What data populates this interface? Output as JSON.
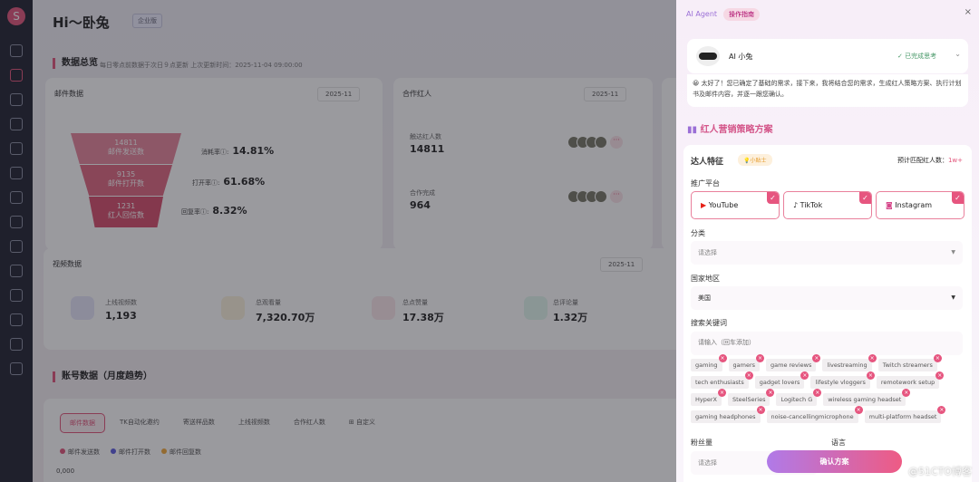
{
  "sidebar": {
    "logo": "S"
  },
  "header": {
    "greeting": "Hi～卧兔",
    "badge": "企业版"
  },
  "overview": {
    "title": "数据总览",
    "subtitle": "每日零点前数据于次日９点更新 上次更新时间：2025-11-04 09:00:00"
  },
  "mail": {
    "title": "邮件数据",
    "date": "2025-11",
    "funnel": [
      {
        "value": "14811",
        "label": "邮件发送数"
      },
      {
        "value": "9135",
        "label": "邮件打开数"
      },
      {
        "value": "1231",
        "label": "红人回信数"
      }
    ],
    "rates": [
      {
        "label": "消耗率",
        "value": "14.81%"
      },
      {
        "label": "打开率",
        "value": "61.68%"
      },
      {
        "label": "回复率",
        "value": "8.32%"
      }
    ]
  },
  "partners": {
    "title": "合作红人",
    "date": "2025-11",
    "items": [
      {
        "label": "触达红人数",
        "value": "14811"
      },
      {
        "label": "合作完成",
        "value": "964"
      }
    ],
    "more": "···"
  },
  "video": {
    "title": "视频数据",
    "date": "2025-11",
    "stats": [
      {
        "label": "上线视频数",
        "value": "1,193",
        "color": "#8b8fe0"
      },
      {
        "label": "总观看量",
        "value": "7,320.70万",
        "color": "#f2c94c"
      },
      {
        "label": "总点赞量",
        "value": "17.38万",
        "color": "#e2557a"
      },
      {
        "label": "总评论量",
        "value": "1.32万",
        "color": "#4fcf9a"
      }
    ]
  },
  "account": {
    "title": "账号数据（月度趋势）",
    "tabs": [
      "邮件数据",
      "TK自动化邀约",
      "寄送样品数",
      "上线视频数",
      "合作红人数"
    ],
    "customize": "自定义",
    "legend": [
      {
        "name": "邮件发送数",
        "color": "#e2557a"
      },
      {
        "name": "邮件打开数",
        "color": "#5b5be0"
      },
      {
        "name": "邮件回复数",
        "color": "#f2a93b"
      }
    ],
    "y_tick": "0,000"
  },
  "panel": {
    "agent": "AI Agent",
    "guide": "操作指南",
    "close": "×",
    "ai_name": "AI 小兔",
    "status": "已完成思考",
    "message": "😀 太好了！您已确定了基础的需求，接下来，我将结合您的需求，生成红人策略方案、执行计划书及邮件内容，并逐一跟您确认。",
    "plan_title": "红人营销策略方案",
    "feature": {
      "title": "达人特征",
      "tip": "小贴士",
      "estimate_label": "预计匹配红人数：",
      "estimate_value": "1w+"
    },
    "platform_label": "推广平台",
    "platforms": [
      {
        "name": "YouTube",
        "color": "#e62117"
      },
      {
        "name": "TikTok",
        "color": "#111"
      },
      {
        "name": "Instagram",
        "color": "#d6478a"
      }
    ],
    "category_label": "分类",
    "category_placeholder": "请选择",
    "region_label": "国家地区",
    "region_value": "美国",
    "keyword_label": "搜索关键词",
    "keyword_placeholder": "请输入（回车添加）",
    "tags": [
      "gaming",
      "gamers",
      "game reviews",
      "livestreaming",
      "Twitch streamers",
      "tech enthusiasts",
      "gadget lovers",
      "lifestyle vloggers",
      "remotework setup",
      "HyperX",
      "SteelSeries",
      "Logitech G",
      "wireless gaming headset",
      "gaming headphones",
      "noise-cancellingmicrophone",
      "multi-platform headset"
    ],
    "followers_label": "粉丝量",
    "followers_placeholder": "请选择",
    "language_label": "语言",
    "confirm": "确认方案"
  },
  "watermark": "@51CTO博客"
}
